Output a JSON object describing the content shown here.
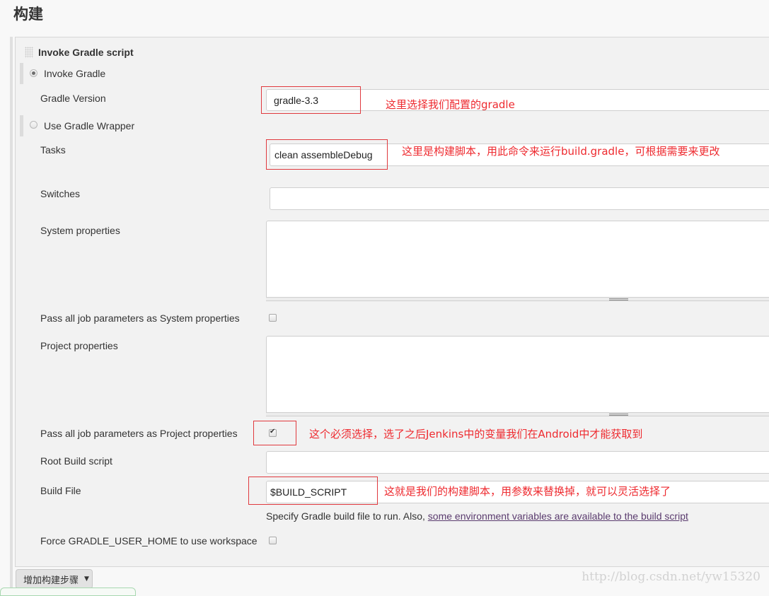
{
  "section_title": "构建",
  "build_step": {
    "title": "Invoke Gradle script",
    "mode_options": [
      {
        "label": "Invoke Gradle",
        "selected": true
      },
      {
        "label": "Use Gradle Wrapper",
        "selected": false
      }
    ],
    "fields": {
      "gradle_version": {
        "label": "Gradle Version",
        "value": "gradle-3.3"
      },
      "tasks": {
        "label": "Tasks",
        "value": "clean assembleDebug"
      },
      "switches": {
        "label": "Switches",
        "value": ""
      },
      "system_properties": {
        "label": "System properties",
        "value": ""
      },
      "pass_system": {
        "label": "Pass all job parameters as System properties",
        "checked": false
      },
      "project_properties": {
        "label": "Project properties",
        "value": ""
      },
      "pass_project": {
        "label": "Pass all job parameters as Project properties",
        "checked": true
      },
      "root_build_script": {
        "label": "Root Build script",
        "value": ""
      },
      "build_file": {
        "label": "Build File",
        "value": "$BUILD_SCRIPT"
      },
      "force_home": {
        "label": "Force GRADLE_USER_HOME to use workspace",
        "checked": false
      }
    },
    "build_file_help": {
      "text": "Specify Gradle build file to run. Also, ",
      "link": "some environment variables are available to the build script"
    }
  },
  "annotations": {
    "gradle_version": "这里选择我们配置的gradle",
    "tasks": "这里是构建脚本，用此命令来运行build.gradle，可根据需要来更改",
    "pass_project": "这个必须选择，选了之后Jenkins中的变量我们在Android中才能获取到",
    "build_file": "这就是我们的构建脚本，用参数来替换掉，就可以灵活选择了"
  },
  "add_step_button": {
    "label": "增加构建步骤",
    "icon": "caret-down-icon"
  },
  "watermark": "http://blog.csdn.net/yw15320",
  "colors": {
    "annotation": "#ee2a2f",
    "link": "#5a3b6e"
  }
}
